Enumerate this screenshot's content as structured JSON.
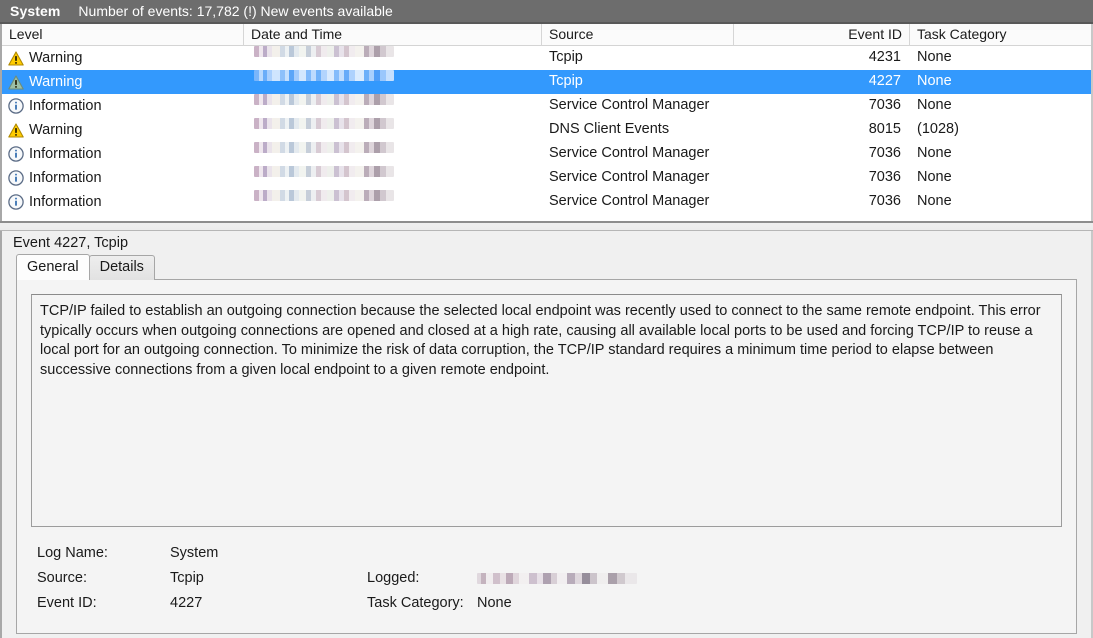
{
  "header": {
    "log_name": "System",
    "status": "Number of events: 17,782 (!) New events available",
    "bg_color": "#6d6d6d"
  },
  "events_list": {
    "columns": [
      {
        "label": "Level",
        "align": "left"
      },
      {
        "label": "Date and Time",
        "align": "left"
      },
      {
        "label": "Source",
        "align": "left"
      },
      {
        "label": "Event ID",
        "align": "right"
      },
      {
        "label": "Task Category",
        "align": "left"
      }
    ],
    "selection_color": "#3399fd",
    "rows": [
      {
        "icon": "warning-icon",
        "level": "Warning",
        "datetime": "",
        "source": "Tcpip",
        "event_id": "4231",
        "task_category": "None",
        "selected": false
      },
      {
        "icon": "warning-icon",
        "level": "Warning",
        "datetime": "",
        "source": "Tcpip",
        "event_id": "4227",
        "task_category": "None",
        "selected": true
      },
      {
        "icon": "info-icon",
        "level": "Information",
        "datetime": "",
        "source": "Service Control Manager",
        "event_id": "7036",
        "task_category": "None",
        "selected": false
      },
      {
        "icon": "warning-icon",
        "level": "Warning",
        "datetime": "",
        "source": "DNS Client Events",
        "event_id": "8015",
        "task_category": "(1028)",
        "selected": false
      },
      {
        "icon": "info-icon",
        "level": "Information",
        "datetime": "",
        "source": "Service Control Manager",
        "event_id": "7036",
        "task_category": "None",
        "selected": false
      },
      {
        "icon": "info-icon",
        "level": "Information",
        "datetime": "",
        "source": "Service Control Manager",
        "event_id": "7036",
        "task_category": "None",
        "selected": false
      },
      {
        "icon": "info-icon",
        "level": "Information",
        "datetime": "",
        "source": "Service Control Manager",
        "event_id": "7036",
        "task_category": "None",
        "selected": false
      }
    ]
  },
  "detail": {
    "title": "Event 4227, Tcpip",
    "tabs": [
      {
        "label": "General",
        "active": true
      },
      {
        "label": "Details",
        "active": false
      }
    ],
    "description": "TCP/IP failed to establish an outgoing connection because the selected local endpoint was recently used to connect to the same remote endpoint. This error typically occurs when outgoing connections are opened and closed at a high rate, causing all available local ports to be used and forcing TCP/IP to reuse a local port for an outgoing connection. To minimize the risk of data corruption, the TCP/IP standard requires a minimum time period to elapse between successive connections from a given local endpoint to a given remote endpoint.",
    "metadata": [
      {
        "label": "Log Name:",
        "value": "System",
        "label2": "",
        "value2": "",
        "value2_redacted": false
      },
      {
        "label": "Source:",
        "value": "Tcpip",
        "label2": "Logged:",
        "value2": "",
        "value2_redacted": true
      },
      {
        "label": "Event ID:",
        "value": "4227",
        "label2": "Task Category:",
        "value2": "None",
        "value2_redacted": false
      }
    ]
  }
}
